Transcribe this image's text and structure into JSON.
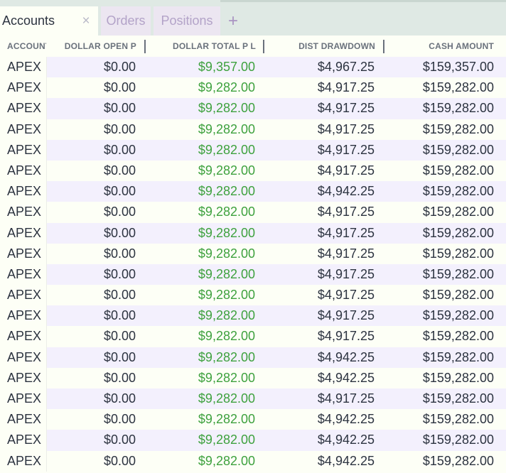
{
  "tabs": {
    "accounts": "Accounts",
    "close_glyph": "×",
    "orders": "Orders",
    "positions": "Positions",
    "add_glyph": "+"
  },
  "columns": [
    "ACCOUNT",
    "DOLLAR OPEN P",
    "DOLLAR TOTAL P L",
    "DIST DRAWDOWN",
    "CASH AMOUNT"
  ],
  "rows": [
    [
      "APEX",
      "$0.00",
      "$9,357.00",
      "$4,967.25",
      "$159,357.00"
    ],
    [
      "APEX",
      "$0.00",
      "$9,282.00",
      "$4,917.25",
      "$159,282.00"
    ],
    [
      "APEX",
      "$0.00",
      "$9,282.00",
      "$4,917.25",
      "$159,282.00"
    ],
    [
      "APEX",
      "$0.00",
      "$9,282.00",
      "$4,917.25",
      "$159,282.00"
    ],
    [
      "APEX",
      "$0.00",
      "$9,282.00",
      "$4,917.25",
      "$159,282.00"
    ],
    [
      "APEX",
      "$0.00",
      "$9,282.00",
      "$4,917.25",
      "$159,282.00"
    ],
    [
      "APEX",
      "$0.00",
      "$9,282.00",
      "$4,942.25",
      "$159,282.00"
    ],
    [
      "APEX",
      "$0.00",
      "$9,282.00",
      "$4,917.25",
      "$159,282.00"
    ],
    [
      "APEX",
      "$0.00",
      "$9,282.00",
      "$4,917.25",
      "$159,282.00"
    ],
    [
      "APEX",
      "$0.00",
      "$9,282.00",
      "$4,917.25",
      "$159,282.00"
    ],
    [
      "APEX",
      "$0.00",
      "$9,282.00",
      "$4,917.25",
      "$159,282.00"
    ],
    [
      "APEX",
      "$0.00",
      "$9,282.00",
      "$4,917.25",
      "$159,282.00"
    ],
    [
      "APEX",
      "$0.00",
      "$9,282.00",
      "$4,917.25",
      "$159,282.00"
    ],
    [
      "APEX",
      "$0.00",
      "$9,282.00",
      "$4,917.25",
      "$159,282.00"
    ],
    [
      "APEX",
      "$0.00",
      "$9,282.00",
      "$4,942.25",
      "$159,282.00"
    ],
    [
      "APEX",
      "$0.00",
      "$9,282.00",
      "$4,942.25",
      "$159,282.00"
    ],
    [
      "APEX",
      "$0.00",
      "$9,282.00",
      "$4,917.25",
      "$159,282.00"
    ],
    [
      "APEX",
      "$0.00",
      "$9,282.00",
      "$4,942.25",
      "$159,282.00"
    ],
    [
      "APEX",
      "$0.00",
      "$9,282.00",
      "$4,942.25",
      "$159,282.00"
    ],
    [
      "APEX",
      "$0.00",
      "$9,282.00",
      "$4,942.25",
      "$159,282.00"
    ]
  ],
  "colors": {
    "positive": "#3ea13e",
    "text": "#2c3340",
    "header_text": "#6a717c",
    "row_alt": "#f3f0fd",
    "row_bg": "#fdfff6",
    "tab_inactive_text": "#b3a3c8"
  }
}
